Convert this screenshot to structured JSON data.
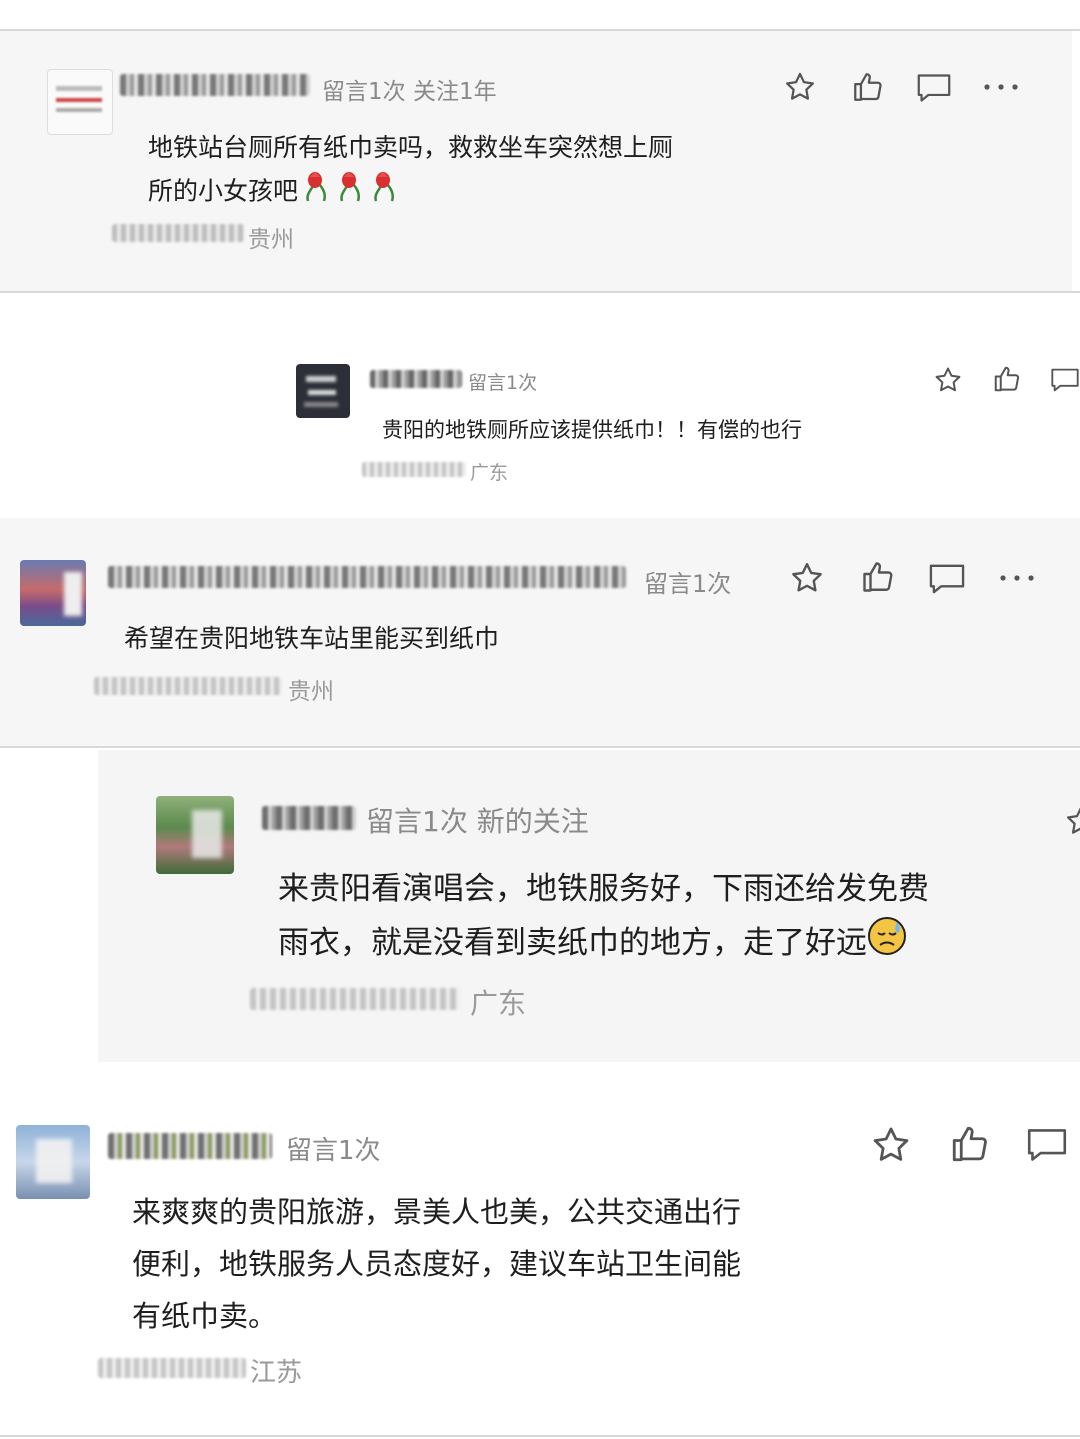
{
  "colors": {
    "panel_bg": "#f7f7f7",
    "text": "#1e1e1e",
    "meta": "#8a8a8a",
    "divider": "#d9d9d9",
    "icon": "#555555"
  },
  "comments": [
    {
      "meta": "留言1次 关注1年",
      "text_lines": [
        "地铁站台厕所有纸巾卖吗，救救坐车突然想上厕",
        "所的小女孩吧"
      ],
      "emoji": [
        "rose-icon",
        "rose-icon",
        "rose-icon"
      ],
      "location": "贵州",
      "icons": [
        "star-icon",
        "thumbs-up-icon",
        "comment-icon",
        "more-icon"
      ]
    },
    {
      "meta": "留言1次",
      "text_lines": [
        "贵阳的地铁厕所应该提供纸巾！！有偿的也行"
      ],
      "location": "广东",
      "icons": [
        "star-icon",
        "thumbs-up-icon",
        "comment-icon"
      ]
    },
    {
      "meta": "留言1次",
      "text_lines": [
        "希望在贵阳地铁车站里能买到纸巾"
      ],
      "location": "贵州",
      "icons": [
        "star-icon",
        "thumbs-up-icon",
        "comment-icon",
        "more-icon"
      ]
    },
    {
      "meta": "留言1次 新的关注",
      "text_lines": [
        "来贵阳看演唱会，地铁服务好，下雨还给发免费",
        "雨衣，就是没看到卖纸巾的地方，走了好远"
      ],
      "emoji": [
        "sweat-face-icon"
      ],
      "location": "广东",
      "icons": [
        "star-icon"
      ]
    },
    {
      "meta": "留言1次",
      "text_lines": [
        "来爽爽的贵阳旅游，景美人也美，公共交通出行",
        "便利，地铁服务人员态度好，建议车站卫生间能",
        "有纸巾卖。"
      ],
      "location": "江苏",
      "icons": [
        "star-icon",
        "thumbs-up-icon",
        "comment-icon"
      ]
    }
  ]
}
